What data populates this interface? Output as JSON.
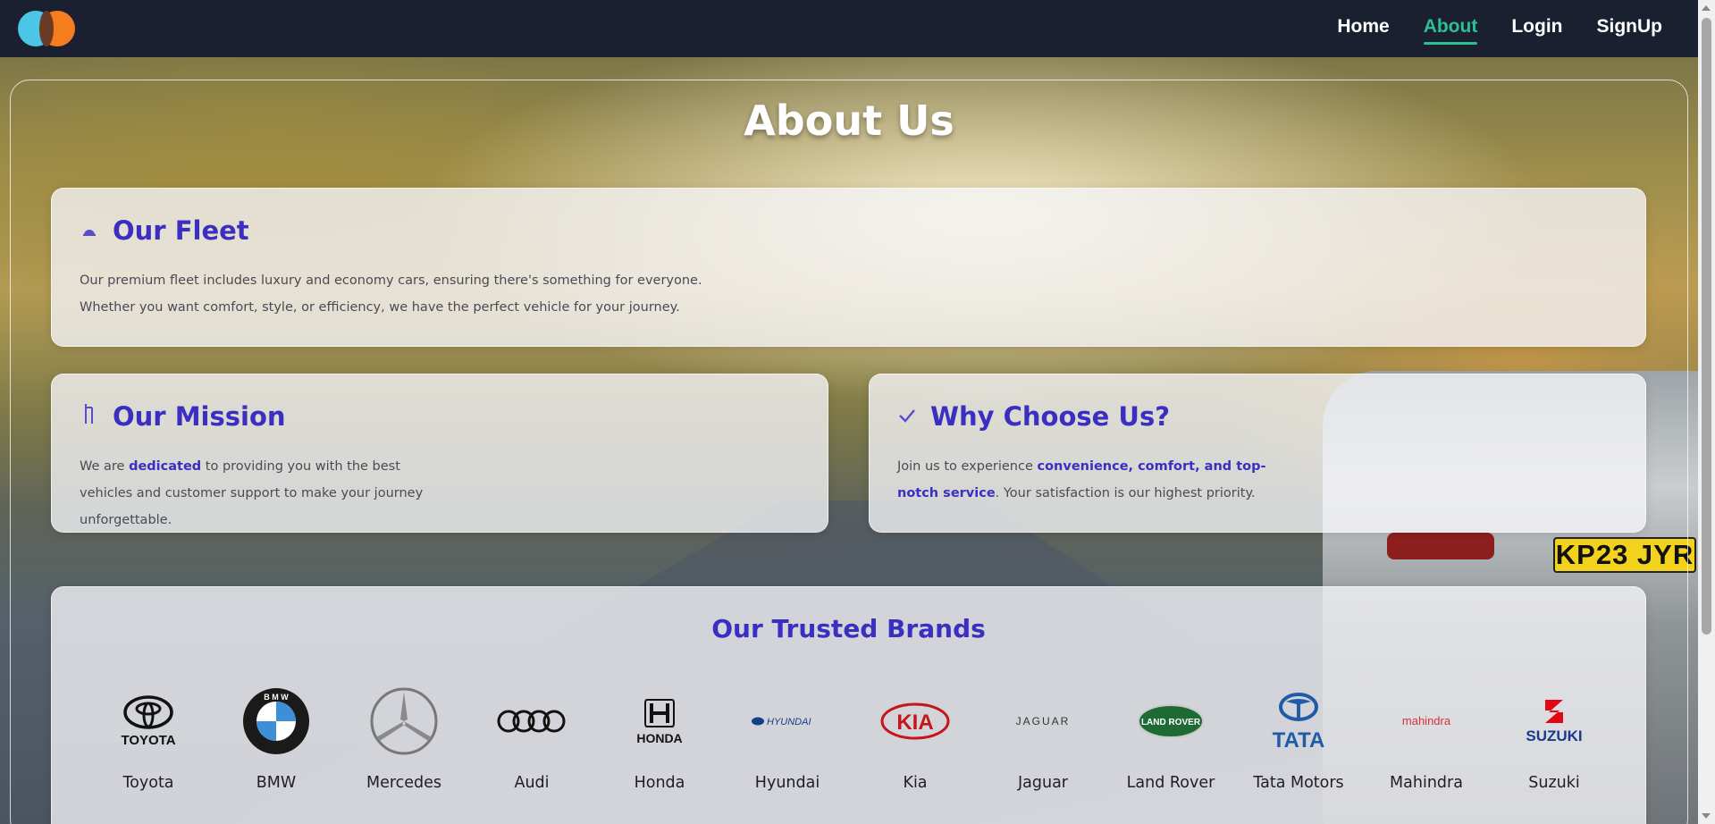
{
  "nav": {
    "logo_alt": "logo",
    "links": [
      {
        "label": "Home",
        "active": false
      },
      {
        "label": "About",
        "active": true
      },
      {
        "label": "Login",
        "active": false
      },
      {
        "label": "SignUp",
        "active": false
      }
    ]
  },
  "page": {
    "title": "About Us"
  },
  "cards": {
    "fleet": {
      "icon": "car-icon",
      "title": "Our Fleet",
      "text": "Our premium fleet includes luxury and economy cars, ensuring there's something for everyone. Whether you want comfort, style, or efficiency, we have the perfect vehicle for your journey."
    },
    "mission": {
      "icon": "flag-icon",
      "title": "Our Mission",
      "text_before": "We are ",
      "highlight": "dedicated",
      "text_after": " to providing you with the best vehicles and customer support to make your journey unforgettable."
    },
    "why": {
      "icon": "check-icon",
      "title": "Why Choose Us?",
      "text_before": "Join us to experience ",
      "highlight": "convenience, comfort, and top-notch service",
      "text_after": ". Your satisfaction is our highest priority."
    }
  },
  "brands": {
    "title": "Our Trusted Brands",
    "items": [
      {
        "name": "Toyota",
        "logo_text": "TOYOTA"
      },
      {
        "name": "BMW",
        "logo_text": "B M W"
      },
      {
        "name": "Mercedes",
        "logo_text": ""
      },
      {
        "name": "Audi",
        "logo_text": ""
      },
      {
        "name": "Honda",
        "logo_text": "HONDA"
      },
      {
        "name": "Hyundai",
        "logo_text": "HYUNDAI"
      },
      {
        "name": "Kia",
        "logo_text": "KIA"
      },
      {
        "name": "Jaguar",
        "logo_text": "JAGUAR"
      },
      {
        "name": "Land Rover",
        "logo_text": "LAND ROVER"
      },
      {
        "name": "Tata Motors",
        "logo_text": "TATA"
      },
      {
        "name": "Mahindra",
        "logo_text": "mahindra"
      },
      {
        "name": "Suzuki",
        "logo_text": "SUZUKI"
      }
    ]
  },
  "background": {
    "plate_text": "KP23 JYR"
  },
  "colors": {
    "accent": "#3a2fc1",
    "nav_active": "#2bbf93",
    "nav_bg": "#1b2030"
  }
}
